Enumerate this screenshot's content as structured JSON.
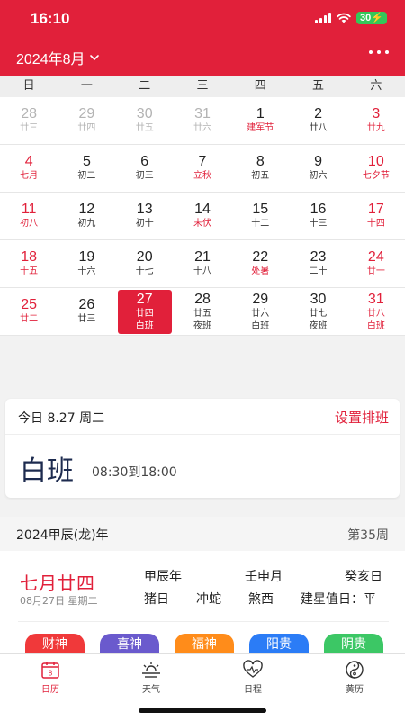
{
  "status_bar": {
    "time": "16:10",
    "battery": "30"
  },
  "header": {
    "month_title": "2024年8月"
  },
  "weekdays": [
    "日",
    "一",
    "二",
    "三",
    "四",
    "五",
    "六"
  ],
  "calendar": [
    [
      {
        "day": "28",
        "lunar": "廿三",
        "other": true
      },
      {
        "day": "29",
        "lunar": "廿四",
        "other": true
      },
      {
        "day": "30",
        "lunar": "廿五",
        "other": true
      },
      {
        "day": "31",
        "lunar": "廿六",
        "other": true
      },
      {
        "day": "1",
        "lunar": "建军节",
        "fest": true
      },
      {
        "day": "2",
        "lunar": "廿八"
      },
      {
        "day": "3",
        "lunar": "廿九"
      }
    ],
    [
      {
        "day": "4",
        "lunar": "七月"
      },
      {
        "day": "5",
        "lunar": "初二"
      },
      {
        "day": "6",
        "lunar": "初三"
      },
      {
        "day": "7",
        "lunar": "立秋",
        "fest": true
      },
      {
        "day": "8",
        "lunar": "初五"
      },
      {
        "day": "9",
        "lunar": "初六"
      },
      {
        "day": "10",
        "lunar": "七夕节"
      }
    ],
    [
      {
        "day": "11",
        "lunar": "初八"
      },
      {
        "day": "12",
        "lunar": "初九"
      },
      {
        "day": "13",
        "lunar": "初十"
      },
      {
        "day": "14",
        "lunar": "末伏",
        "fest": true
      },
      {
        "day": "15",
        "lunar": "十二"
      },
      {
        "day": "16",
        "lunar": "十三"
      },
      {
        "day": "17",
        "lunar": "十四"
      }
    ],
    [
      {
        "day": "18",
        "lunar": "十五"
      },
      {
        "day": "19",
        "lunar": "十六"
      },
      {
        "day": "20",
        "lunar": "十七"
      },
      {
        "day": "21",
        "lunar": "十八"
      },
      {
        "day": "22",
        "lunar": "处暑",
        "fest": true
      },
      {
        "day": "23",
        "lunar": "二十"
      },
      {
        "day": "24",
        "lunar": "廿一"
      }
    ],
    [
      {
        "day": "25",
        "lunar": "廿二"
      },
      {
        "day": "26",
        "lunar": "廿三"
      },
      {
        "day": "27",
        "lunar": "廿四",
        "shift": "白班",
        "selected": true
      },
      {
        "day": "28",
        "lunar": "廿五",
        "shift": "夜班"
      },
      {
        "day": "29",
        "lunar": "廿六",
        "shift": "白班"
      },
      {
        "day": "30",
        "lunar": "廿七",
        "shift": "夜班"
      },
      {
        "day": "31",
        "lunar": "廿八",
        "shift": "白班"
      }
    ]
  ],
  "shift_card": {
    "date_label": "今日 8.27 周二",
    "set_label": "设置排班",
    "shift_name": "白班",
    "shift_time": "08:30到18:00"
  },
  "almanac": {
    "year_label": "2024甲辰(龙)年",
    "week_label": "第35周",
    "lunar_date": "七月廿四",
    "solar_date": "08月27日 星期二",
    "year_gz": "甲辰年",
    "month_gz": "壬申月",
    "day_gz": "癸亥日",
    "zodiac_day": "猪日",
    "clash": "冲蛇",
    "evil": "煞西",
    "star": "建星值日：平"
  },
  "gods": [
    {
      "label": "财神",
      "color": "#f0393a"
    },
    {
      "label": "喜神",
      "color": "#6a5acd"
    },
    {
      "label": "福神",
      "color": "#ff8c1a"
    },
    {
      "label": "阳贵",
      "color": "#2b7cf6"
    },
    {
      "label": "阴贵",
      "color": "#3cc765"
    }
  ],
  "tabs": [
    {
      "label": "日历",
      "icon": "calendar-icon",
      "badge": "8",
      "active": true
    },
    {
      "label": "天气",
      "icon": "weather-icon"
    },
    {
      "label": "日程",
      "icon": "schedule-heart-icon"
    },
    {
      "label": "黄历",
      "icon": "yin-yang-icon"
    }
  ],
  "colors": {
    "accent": "#e1203a",
    "battery": "#34c759"
  }
}
